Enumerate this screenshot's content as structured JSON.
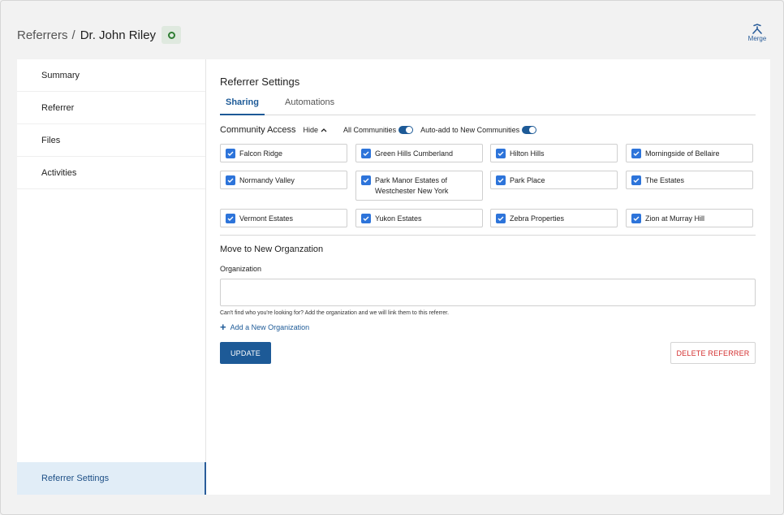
{
  "breadcrumb": {
    "parent": "Referrers",
    "separator": "/",
    "current": "Dr. John Riley",
    "status_color": "#2e7d32"
  },
  "merge": {
    "label": "Merge",
    "icon": "merge-icon"
  },
  "sidebar": {
    "items": [
      {
        "label": "Summary"
      },
      {
        "label": "Referrer"
      },
      {
        "label": "Files"
      },
      {
        "label": "Activities"
      }
    ],
    "active": {
      "label": "Referrer Settings"
    }
  },
  "main": {
    "title": "Referrer Settings",
    "tabs": [
      {
        "label": "Sharing",
        "active": true
      },
      {
        "label": "Automations",
        "active": false
      }
    ],
    "community_access": {
      "label": "Community Access",
      "hide_label": "Hide",
      "all_communities_label": "All Communities",
      "all_communities_on": true,
      "auto_add_label": "Auto-add to New Communities",
      "auto_add_on": true,
      "communities": [
        {
          "name": "Falcon Ridge",
          "checked": true
        },
        {
          "name": "Green Hills Cumberland",
          "checked": true
        },
        {
          "name": "Hilton Hills",
          "checked": true
        },
        {
          "name": "Morningside of Bellaire",
          "checked": true
        },
        {
          "name": "Normandy Valley",
          "checked": true
        },
        {
          "name": "Park Manor Estates of Westchester New York",
          "checked": true
        },
        {
          "name": "Park Place",
          "checked": true
        },
        {
          "name": "The Estates",
          "checked": true
        },
        {
          "name": "Vermont Estates",
          "checked": true
        },
        {
          "name": "Yukon Estates",
          "checked": true
        },
        {
          "name": "Zebra Properties",
          "checked": true
        },
        {
          "name": "Zion at Murray Hill",
          "checked": true
        }
      ]
    },
    "move": {
      "title": "Move to New Organzation",
      "org_label": "Organization",
      "org_value": "",
      "helper": "Can't find who you're looking for? Add the organization and we will link them to this referrer.",
      "add_label": "Add a New Organization"
    },
    "actions": {
      "update": "UPDATE",
      "delete": "DELETE REFERRER"
    }
  },
  "colors": {
    "accent": "#1d5a97",
    "checkbox": "#2d74da",
    "danger": "#d32f2f",
    "active_bg": "#e1edf7"
  }
}
